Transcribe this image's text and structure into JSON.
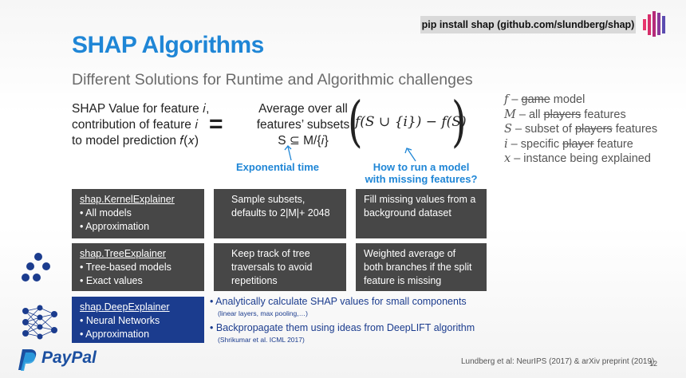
{
  "badge": "pip install shap (github.com/slundberg/shap)",
  "title": "SHAP Algorithms",
  "subtitle": "Different Solutions for Runtime and Algorithmic challenges",
  "lhs": {
    "line1": "SHAP Value for feature 𝑖,",
    "line2": "contribution of feature 𝑖",
    "line3": "to model prediction 𝑓(𝑥)"
  },
  "equals": "=",
  "avg": {
    "line1": "Average over all",
    "line2": "features’ subsets",
    "line3": "S ⊆ M/{𝑖}"
  },
  "formula": "f(S ∪ {i}) − f(S)",
  "annot_left": "Exponential time",
  "annot_right": {
    "line1": "How to run a model",
    "line2": "with missing features?"
  },
  "legend": [
    {
      "sym": "f",
      "sep": " – ",
      "strike": "game",
      "rest": " model"
    },
    {
      "sym": "M",
      "sep": " – all ",
      "strike": "players",
      "rest": " features"
    },
    {
      "sym": "S",
      "sep": " – subset of ",
      "strike": "players",
      "rest": " features"
    },
    {
      "sym": "i",
      "sep": " – specific ",
      "strike": "player",
      "rest": " feature"
    },
    {
      "sym": "x",
      "sep": " – instance being explained",
      "strike": "",
      "rest": ""
    }
  ],
  "rows": {
    "kernel": {
      "head": "shap.KernelExplainer",
      "items": [
        "All models",
        "Approximation"
      ],
      "mid": [
        "Sample subsets,",
        "defaults to 2|M|+ 2048"
      ],
      "right": [
        "Fill missing values from a",
        "background dataset"
      ]
    },
    "tree": {
      "head": "shap.TreeExplainer",
      "items": [
        "Tree-based models",
        "Exact values"
      ],
      "mid": [
        "Keep track of tree",
        "traversals to avoid",
        "repetitions"
      ],
      "right": [
        "Weighted average of",
        "both branches if the split",
        "feature is missing"
      ]
    },
    "deep": {
      "head": "shap.DeepExplainer",
      "items": [
        "Neural Networks",
        "Approximation"
      ]
    }
  },
  "deep_bullets": [
    {
      "main": "Analytically calculate SHAP values for small components",
      "sub": "(linear layers, max pooling,…)"
    },
    {
      "main": "Backpropagate them using ideas from DeepLIFT algorithm",
      "sub": "(Shrikumar et al. ICML 2017)"
    }
  ],
  "citation": "Lundberg et al: NeurIPS (2017) & arXiv preprint  (2019)",
  "page_number": "12",
  "brand": "PayPal",
  "colors": {
    "accent": "#1f86d6",
    "dark_box": "#474747",
    "blue_box": "#1b3c8e",
    "paypal": "#1b4fa0"
  }
}
